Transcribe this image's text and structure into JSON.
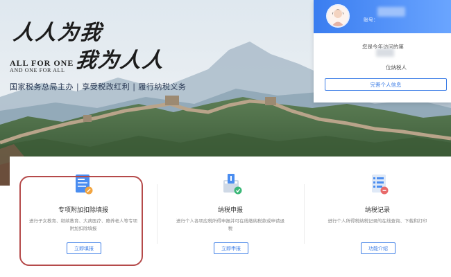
{
  "banner": {
    "calligraphy_line1": "人人为我",
    "calligraphy_line2": "我为人人",
    "english_line1": "ALL FOR ONE",
    "english_line2": "AND ONE FOR ALL",
    "slogan": "国家税务总局主办 | 享受税改红利 | 履行纳税义务"
  },
  "user": {
    "account_label": "账号：",
    "visit_text": "您是今年访问的第",
    "rank_text": "位纳税人",
    "profile_button": "完善个人信息"
  },
  "services": [
    {
      "title": "专项附加扣除填报",
      "description": "进行子女教育、继续教育、大病医疗、赡养老人等专项附加扣除填报",
      "button": "立即填报",
      "icon": "form-edit-icon"
    },
    {
      "title": "纳税申报",
      "description": "进行个人各项应税所得申报并可在线缴纳税款或申请退税",
      "button": "立即申报",
      "icon": "tax-declare-icon"
    },
    {
      "title": "纳税记录",
      "description": "进行个人所得税纳税记录的在线查询、下载和打印",
      "button": "功能介绍",
      "icon": "tax-record-icon"
    }
  ],
  "colors": {
    "accent": "#3c7de6",
    "highlight": "#b54a4a"
  }
}
